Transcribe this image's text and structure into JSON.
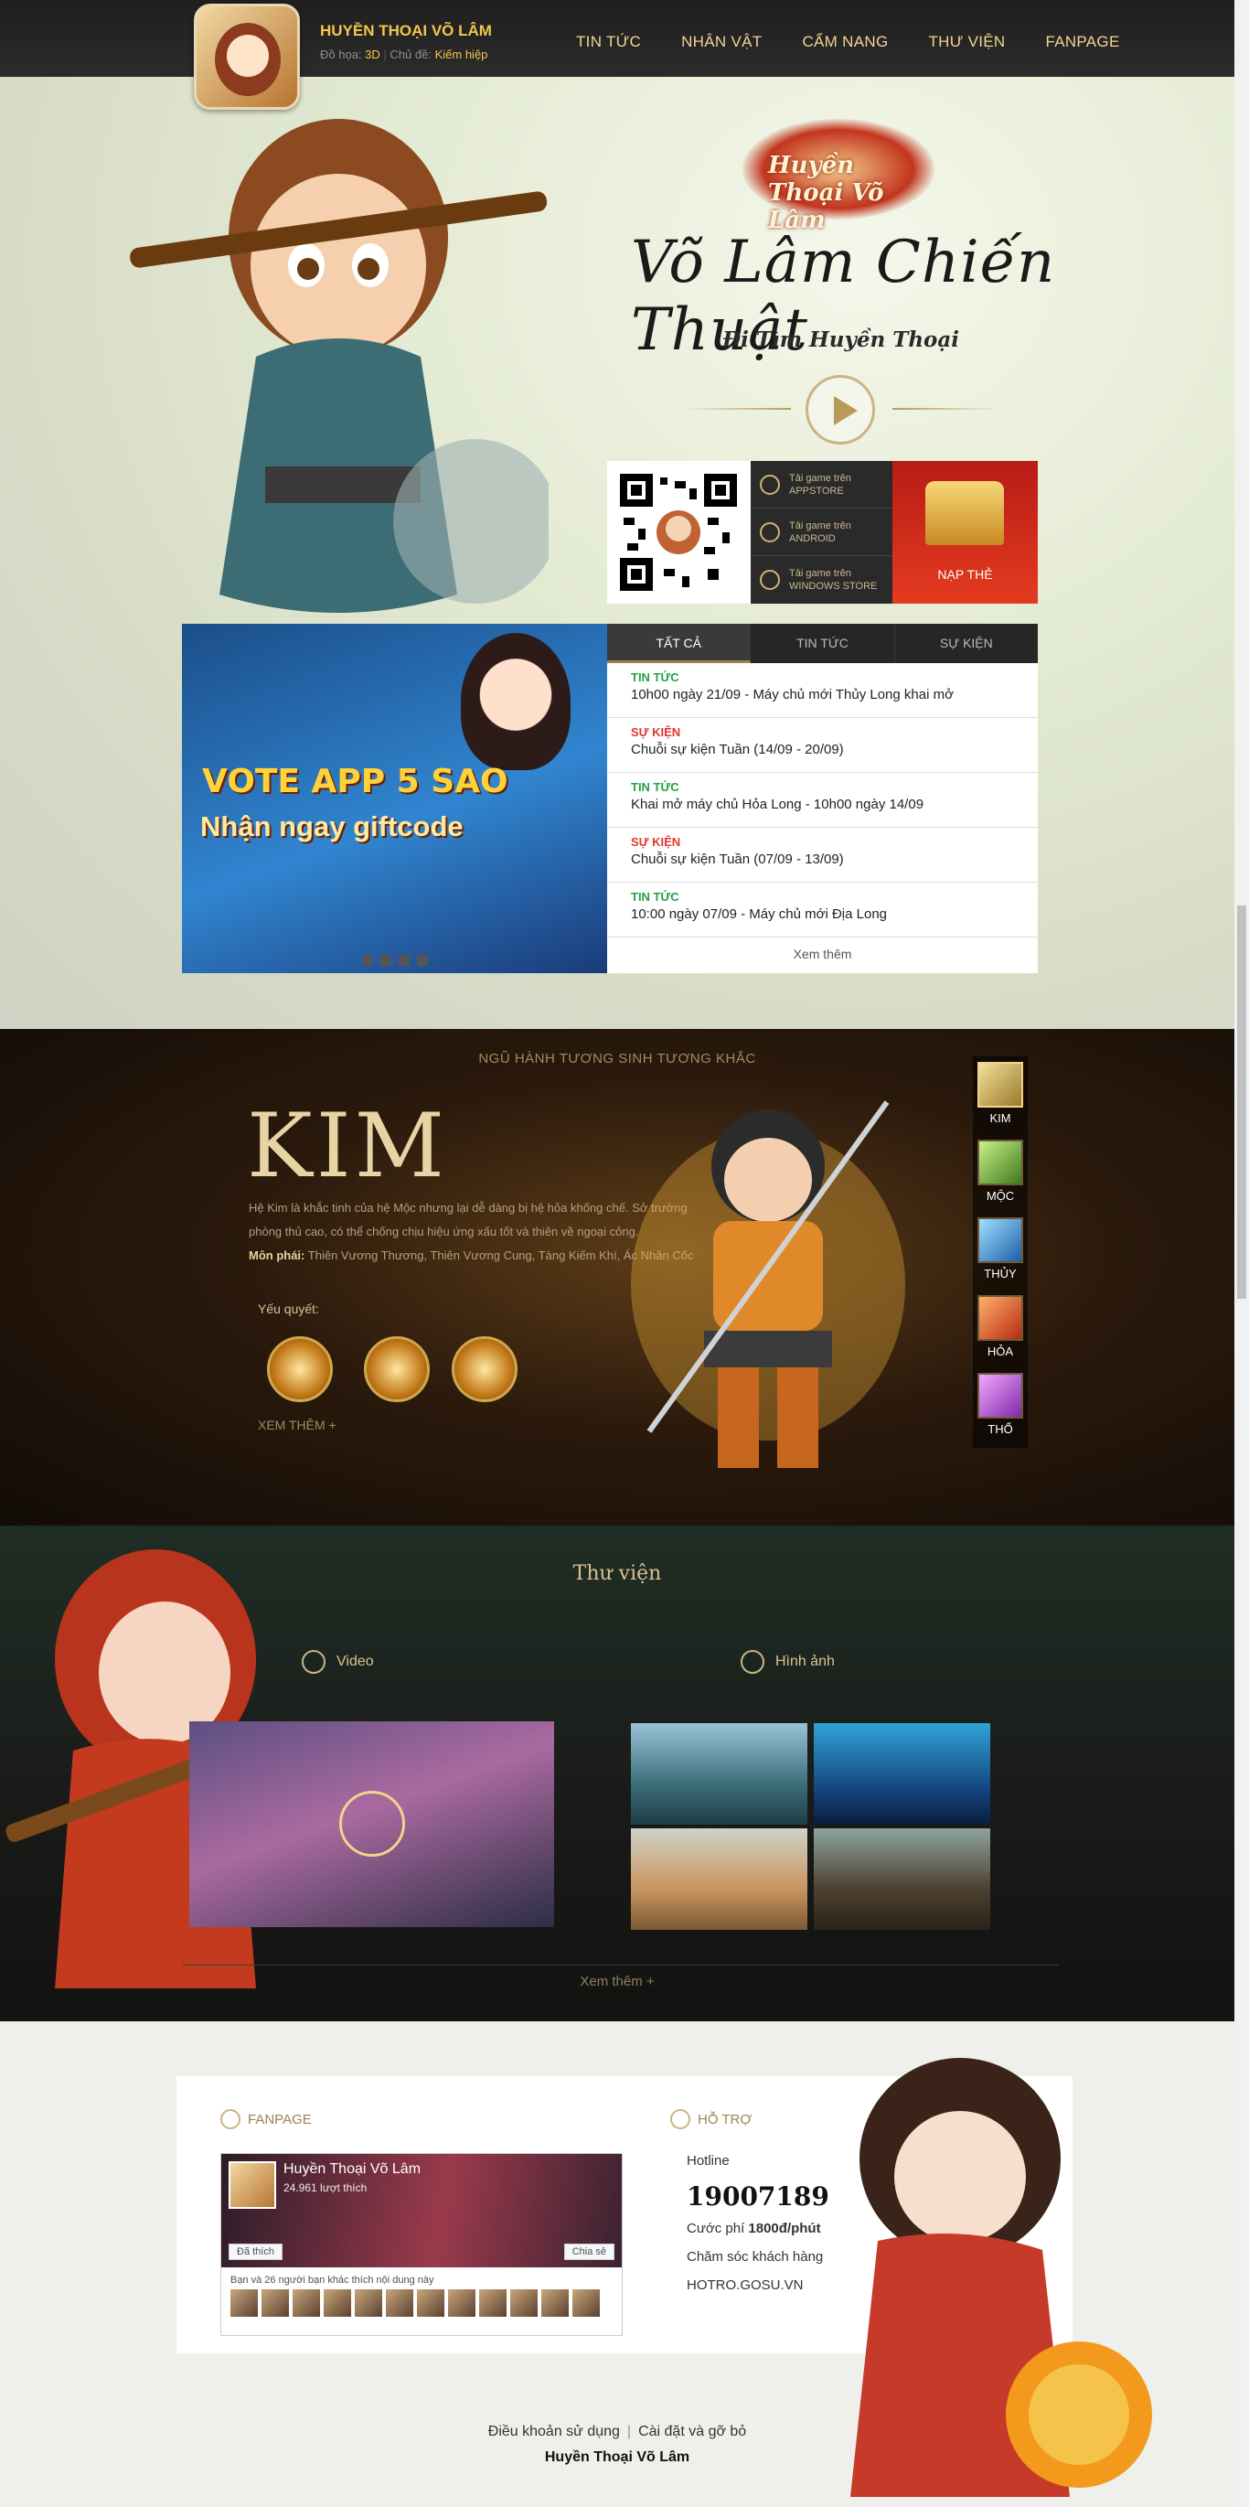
{
  "header": {
    "brand_name": "HUYỀN THOẠI VÕ LÂM",
    "graphics_label": "Đồ họa:",
    "graphics_value": "3D",
    "theme_label": "Chủ đề:",
    "theme_value": "Kiếm hiệp",
    "nav": [
      "TIN TỨC",
      "NHÂN VẬT",
      "CẨM NANG",
      "THƯ VIỆN",
      "FANPAGE"
    ]
  },
  "hero": {
    "logo_text": "Huyền Thoại Võ Lâm",
    "calligraphy": "Võ Lâm Chiến Thuật",
    "tagline": "Đi Tìm Huyền Thoại"
  },
  "download": {
    "stores": [
      {
        "line1": "Tải game trên",
        "line2": "APPSTORE"
      },
      {
        "line1": "Tải game trên",
        "line2": "ANDROID"
      },
      {
        "line1": "Tải game trên",
        "line2": "WINDOWS STORE"
      }
    ],
    "topup": "NẠP THẺ"
  },
  "banner": {
    "line1": "VOTE APP 5 SAO",
    "line2": "Nhận ngay giftcode"
  },
  "news": {
    "tabs": [
      "TẤT CẢ",
      "TIN TỨC",
      "SỰ KIỆN"
    ],
    "items": [
      {
        "cat": "TIN TỨC",
        "title": "10h00 ngày 21/09 - Máy chủ mới Thủy Long khai mở"
      },
      {
        "cat": "SỰ KIỆN",
        "title": "Chuỗi sự kiện Tuần (14/09 - 20/09)"
      },
      {
        "cat": "TIN TỨC",
        "title": "Khai mở máy chủ Hỏa Long - 10h00 ngày 14/09"
      },
      {
        "cat": "SỰ KIỆN",
        "title": "Chuỗi sự kiện Tuần (07/09 - 13/09)"
      },
      {
        "cat": "TIN TỨC",
        "title": "10:00 ngày 07/09 - Máy chủ mới Địa Long"
      }
    ],
    "more": "Xem thêm"
  },
  "elements": {
    "heading": "NGŨ HÀNH TƯƠNG SINH TƯƠNG KHẮC",
    "name": "KIM",
    "description": "Hệ Kim là khắc tinh của hệ Mộc nhưng lại dễ dàng bị hệ hỏa khống chế. Sở trường phòng thủ cao, có thể chống chịu hiệu ứng xấu tốt và thiên về ngoại công.",
    "school_label": "Môn phái:",
    "school_value": "Thiên Vương Thương, Thiên Vương Cung, Tàng Kiếm Khí, Ác Nhân Cốc",
    "skills_label": "Yếu quyết:",
    "more": "XEM THÊM +",
    "tabs": [
      "KIM",
      "MỘC",
      "THỦY",
      "HỎA",
      "THỔ"
    ]
  },
  "library": {
    "title": "Thư viện",
    "video_label": "Video",
    "image_label": "Hình ảnh",
    "more": "Xem thêm +"
  },
  "footer": {
    "fanpage_label": "FANPAGE",
    "support_label": "HỖ TRỢ",
    "fb": {
      "name": "Huyền Thoại Võ Lâm",
      "likes": "24.961 lượt thích",
      "like_btn": "Đã thích",
      "share_btn": "Chia sẻ",
      "friends": "Bạn và 26 người bạn khác thích nội dung này"
    },
    "hotline_label": "Hotline",
    "hotline_number": "19007189",
    "fee_label": "Cước phí",
    "fee_value": "1800đ/phút",
    "care_label": "Chăm sóc khách hàng",
    "support_site": "HOTRO.GOSU.VN",
    "links": [
      "Điều khoản sử dụng",
      "Cài đặt và gỡ bỏ"
    ],
    "bottom_name": "Huyền Thoại Võ Lâm"
  }
}
